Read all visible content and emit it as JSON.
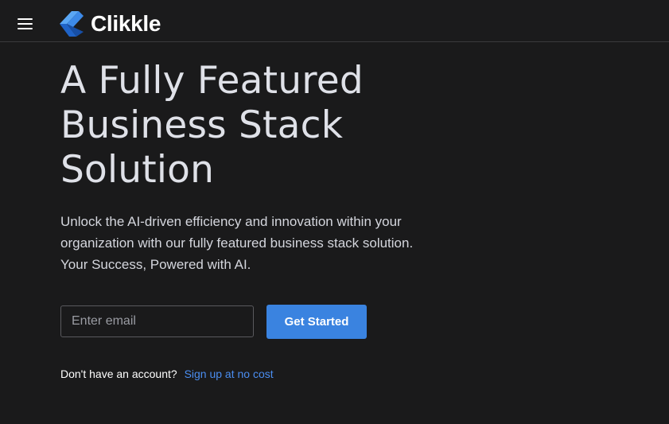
{
  "header": {
    "menu_icon": "hamburger-menu-icon",
    "logo_icon": "clikkle-logo-icon",
    "brand_name": "Clikkle",
    "colors": {
      "logo_light": "#5aa7f5",
      "logo_dark": "#1f63c7"
    }
  },
  "hero": {
    "title_line1": "A Fully Featured",
    "title_line2": "Business Stack",
    "title_line3": "Solution",
    "subtitle_line1": "Unlock the AI-driven efficiency and innovation within your",
    "subtitle_line2": "organization with our fully featured business stack solution.",
    "subtitle_line3": "Your Success, Powered with AI."
  },
  "signup": {
    "email_placeholder": "Enter email",
    "email_value": "",
    "button_label": "Get Started"
  },
  "account": {
    "prompt": "Don't have an account?",
    "link_label": "Sign up at no cost"
  },
  "colors": {
    "background": "#1a1a1b",
    "accent": "#3a83e0",
    "link": "#4a8df0"
  }
}
